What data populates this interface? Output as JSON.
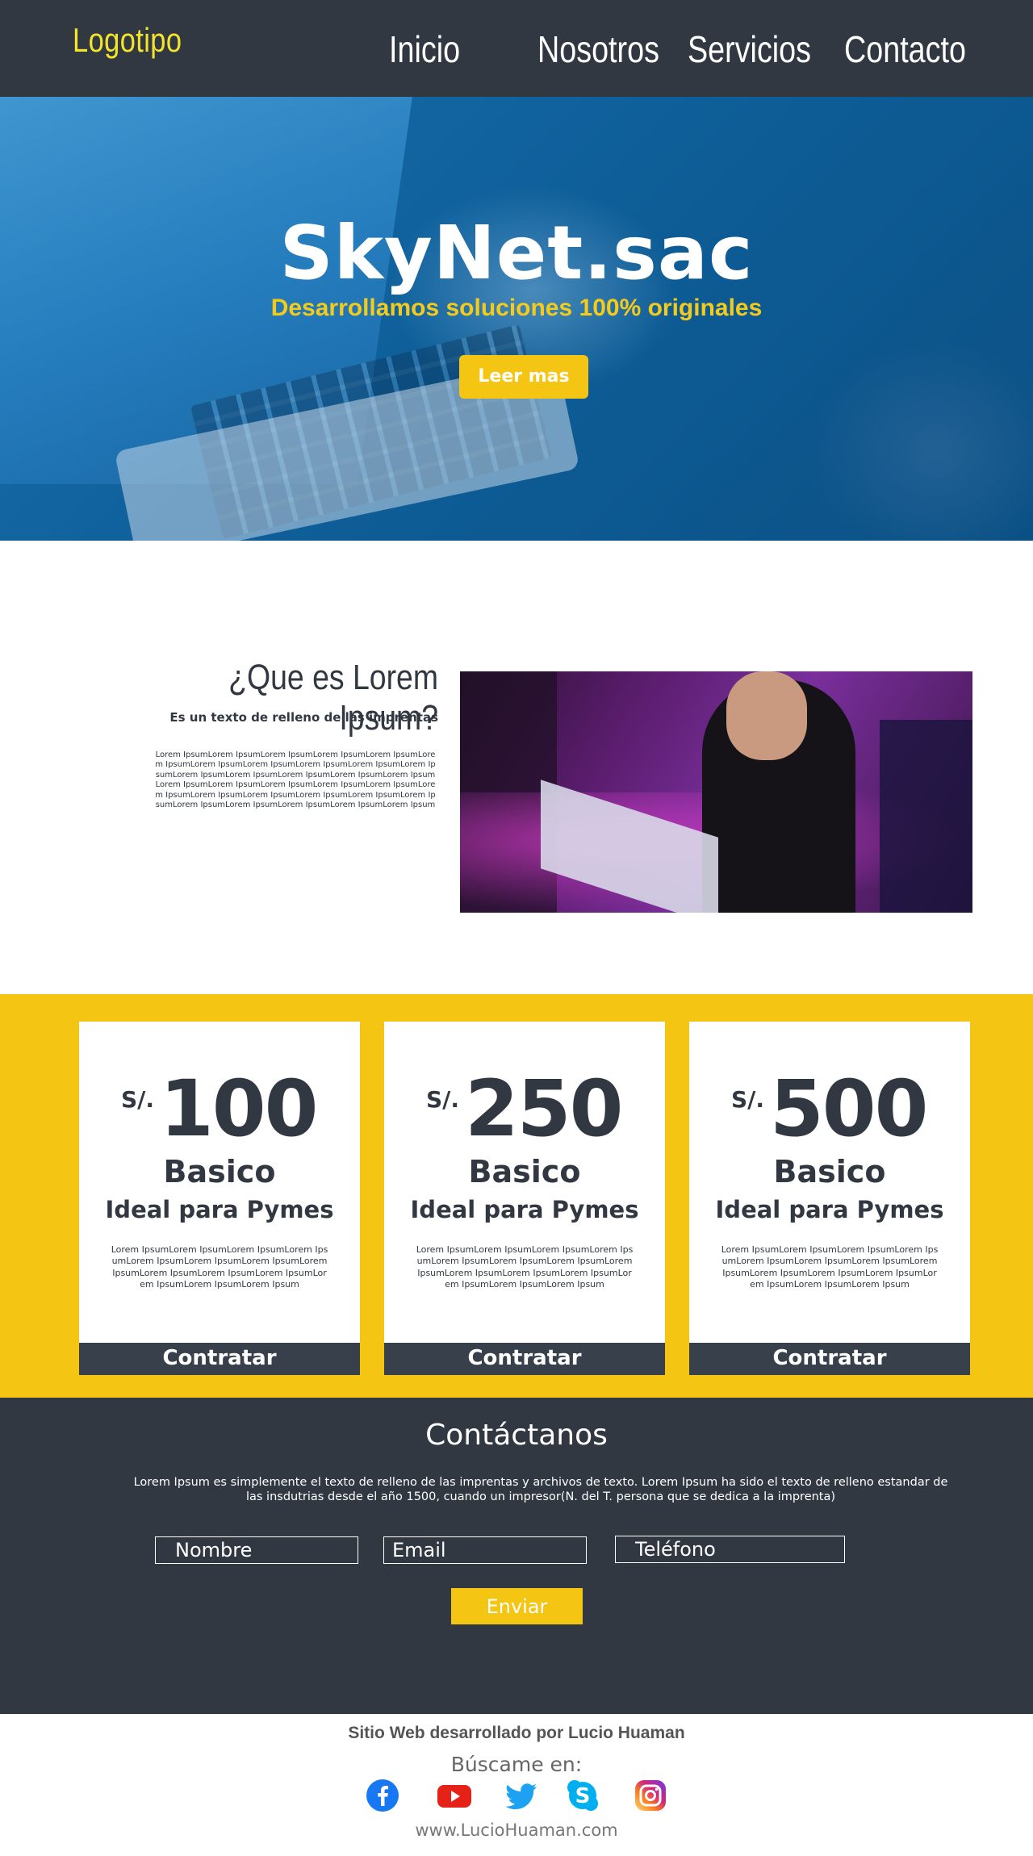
{
  "header": {
    "logo": "Logotipo",
    "nav": [
      "Inicio",
      "Nosotros",
      "Servicios",
      "Contacto"
    ]
  },
  "hero": {
    "title": "SkyNet.sac",
    "subtitle": "Desarrollamos soluciones 100% originales",
    "button": "Leer mas"
  },
  "about": {
    "title": "¿Que es Lorem Ipsum?",
    "subtitle": "Es un texto de relleno de las imprentas",
    "body": "Lorem IpsumLorem IpsumLorem IpsumLorem IpsumLorem IpsumLorem IpsumLorem IpsumLorem IpsumLorem IpsumLorem IpsumLorem IpsumLorem IpsumLorem IpsumLorem IpsumLorem IpsumLorem IpsumLorem IpsumLorem IpsumLorem IpsumLorem IpsumLorem IpsumLorem IpsumLorem IpsumLorem IpsumLorem IpsumLorem IpsumLorem IpsumLorem IpsumLorem IpsumLorem IpsumLorem IpsumLorem Ipsum"
  },
  "pricing": {
    "cards": [
      {
        "currency": "S/.",
        "price": "100",
        "plan": "Basico",
        "tagline": "Ideal para Pymes",
        "desc": "Lorem IpsumLorem IpsumLorem IpsumLorem IpsumLorem IpsumLorem IpsumLorem IpsumLorem IpsumLorem IpsumLorem IpsumLorem IpsumLorem IpsumLorem IpsumLorem Ipsum",
        "button": "Contratar"
      },
      {
        "currency": "S/.",
        "price": "250",
        "plan": "Basico",
        "tagline": "Ideal para Pymes",
        "desc": "Lorem IpsumLorem IpsumLorem IpsumLorem IpsumLorem IpsumLorem IpsumLorem IpsumLorem IpsumLorem IpsumLorem IpsumLorem IpsumLorem IpsumLorem IpsumLorem Ipsum",
        "button": "Contratar"
      },
      {
        "currency": "S/.",
        "price": "500",
        "plan": "Basico",
        "tagline": "Ideal para Pymes",
        "desc": "Lorem IpsumLorem IpsumLorem IpsumLorem IpsumLorem IpsumLorem IpsumLorem IpsumLorem IpsumLorem IpsumLorem IpsumLorem IpsumLorem IpsumLorem IpsumLorem Ipsum",
        "button": "Contratar"
      }
    ]
  },
  "contact": {
    "title": "Contáctanos",
    "text": "Lorem Ipsum es simplemente el texto de relleno de las imprentas y archivos de texto. Lorem Ipsum ha sido el texto de relleno estandar de las insdutrias desde el año 1500, cuando un impresor(N. del T. persona que se dedica a la imprenta)",
    "name_placeholder": "Nombre",
    "email_placeholder": "Email",
    "phone_placeholder": "Teléfono",
    "send": "Enviar"
  },
  "footer": {
    "credit": "Sitio Web desarrollado por Lucio Huaman",
    "find": "Búscame en:",
    "url": "www.LucioHuaman.com",
    "socials": [
      "facebook-icon",
      "youtube-icon",
      "twitter-icon",
      "skype-icon",
      "instagram-icon"
    ]
  },
  "colors": {
    "dark": "#323842",
    "yellow": "#f4c513",
    "logo_yellow": "#f2e52b",
    "hero_blue": "#0e5f9a"
  }
}
